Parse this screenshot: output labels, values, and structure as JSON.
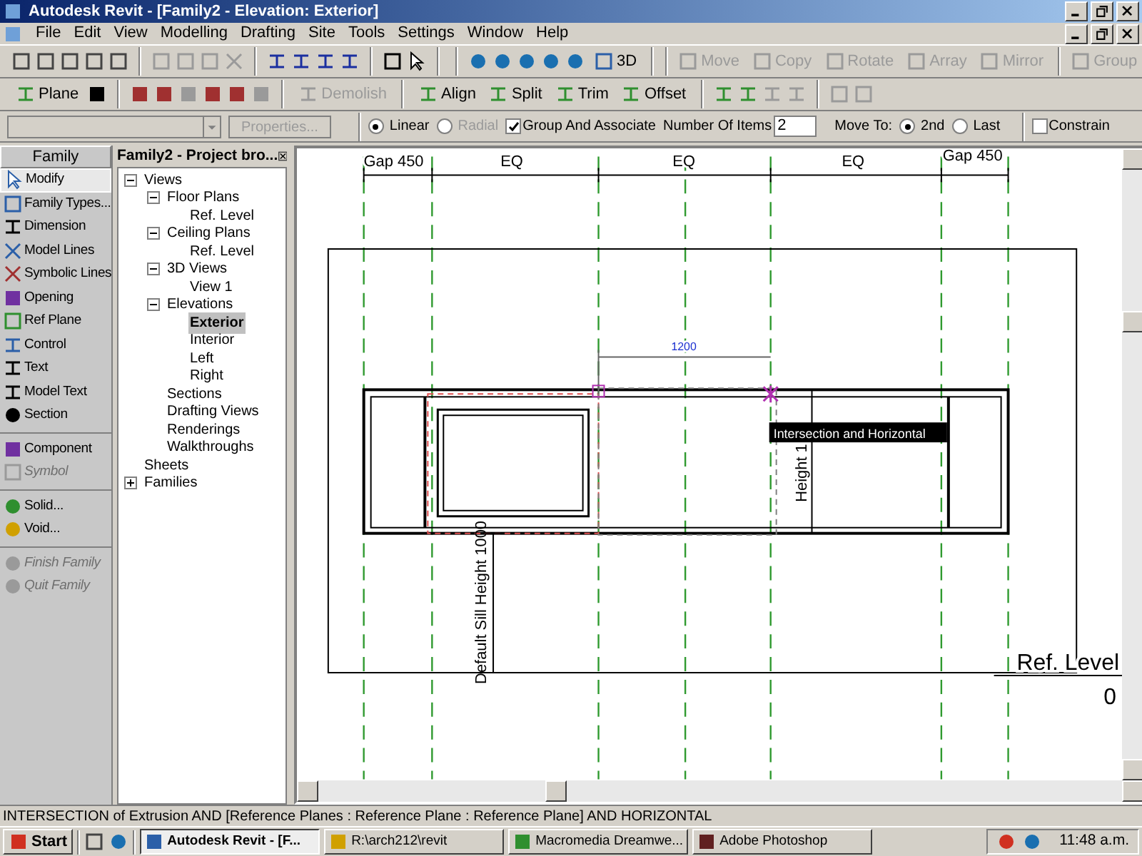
{
  "window": {
    "title": "Autodesk Revit - [Family2 - Elevation: Exterior]"
  },
  "menu": [
    "File",
    "Edit",
    "View",
    "Modelling",
    "Drafting",
    "Site",
    "Tools",
    "Settings",
    "Window",
    "Help"
  ],
  "toolbar_1": [
    {
      "label": "3D",
      "disabled": false
    },
    {
      "label": "Move",
      "disabled": true
    },
    {
      "label": "Copy",
      "disabled": true
    },
    {
      "label": "Rotate",
      "disabled": true
    },
    {
      "label": "Array",
      "disabled": true
    },
    {
      "label": "Mirror",
      "disabled": true
    },
    {
      "label": "Group",
      "disabled": true
    }
  ],
  "toolbar_2": [
    {
      "label": "Plane",
      "disabled": false
    },
    {
      "label": "Demolish",
      "disabled": true
    },
    {
      "label": "Align",
      "disabled": false
    },
    {
      "label": "Split",
      "disabled": false
    },
    {
      "label": "Trim",
      "disabled": false
    },
    {
      "label": "Offset",
      "disabled": false
    }
  ],
  "options_bar": {
    "properties_button": {
      "label": "Properties...",
      "disabled": true
    },
    "array_type": [
      {
        "label": "Linear",
        "selected": true,
        "disabled": false
      },
      {
        "label": "Radial",
        "selected": false,
        "disabled": true
      }
    ],
    "group_and_associate": {
      "label": "Group And Associate",
      "checked": true
    },
    "number_of_items": {
      "label": "Number Of Items",
      "value": "2"
    },
    "move_to": {
      "label": "Move To:",
      "options": [
        {
          "label": "2nd",
          "selected": true
        },
        {
          "label": "Last",
          "selected": false
        }
      ]
    },
    "constrain": {
      "label": "Constrain",
      "checked": false
    }
  },
  "family_panel": {
    "title": "Family",
    "items": [
      {
        "label": "Modify",
        "selected": true,
        "disabled": false
      },
      {
        "label": "Family Types...",
        "selected": false,
        "disabled": false
      },
      {
        "label": "Dimension",
        "selected": false,
        "disabled": false
      },
      {
        "label": "Model Lines",
        "selected": false,
        "disabled": false
      },
      {
        "label": "Symbolic Lines",
        "selected": false,
        "disabled": false
      },
      {
        "label": "Opening",
        "selected": false,
        "disabled": false
      },
      {
        "label": "Ref Plane",
        "selected": false,
        "disabled": false
      },
      {
        "label": "Control",
        "selected": false,
        "disabled": false
      },
      {
        "label": "Text",
        "selected": false,
        "disabled": false
      },
      {
        "label": "Model Text",
        "selected": false,
        "disabled": false
      },
      {
        "label": "Section",
        "selected": false,
        "disabled": false
      },
      {
        "label": "Component",
        "selected": false,
        "disabled": false
      },
      {
        "label": "Symbol",
        "selected": false,
        "disabled": true
      },
      {
        "label": "Solid...",
        "selected": false,
        "disabled": false
      },
      {
        "label": "Void...",
        "selected": false,
        "disabled": false
      },
      {
        "label": "Finish Family",
        "selected": false,
        "disabled": true
      },
      {
        "label": "Quit Family",
        "selected": false,
        "disabled": true
      }
    ]
  },
  "project_browser": {
    "title": "Family2 - Project bro...",
    "tree": [
      {
        "label": "Views",
        "expanded": true,
        "selected": false,
        "children": [
          {
            "label": "Floor Plans",
            "expanded": true,
            "selected": false,
            "children": [
              {
                "label": "Ref. Level",
                "selected": false
              }
            ]
          },
          {
            "label": "Ceiling Plans",
            "expanded": true,
            "selected": false,
            "children": [
              {
                "label": "Ref. Level",
                "selected": false
              }
            ]
          },
          {
            "label": "3D Views",
            "expanded": true,
            "selected": false,
            "children": [
              {
                "label": "View 1",
                "selected": false
              }
            ]
          },
          {
            "label": "Elevations",
            "expanded": true,
            "selected": false,
            "children": [
              {
                "label": "Exterior",
                "selected": true
              },
              {
                "label": "Interior",
                "selected": false
              },
              {
                "label": "Left",
                "selected": false
              },
              {
                "label": "Right",
                "selected": false
              }
            ]
          },
          {
            "label": "Sections",
            "selected": false
          },
          {
            "label": "Drafting Views",
            "selected": false
          },
          {
            "label": "Renderings",
            "selected": false
          },
          {
            "label": "Walkthroughs",
            "selected": false
          }
        ]
      },
      {
        "label": "Sheets",
        "selected": false
      },
      {
        "label": "Families",
        "expanded": false,
        "selected": false
      }
    ]
  },
  "drawing": {
    "top_dimensions": [
      "Gap 450",
      "EQ",
      "EQ",
      "EQ",
      "Gap 450"
    ],
    "temp_dimension": "1200",
    "sill_dimension": "Default Sill Height 1000",
    "height_dimension": "Height 1",
    "tooltip": "Intersection and Horizontal",
    "level_name": "Ref. Level",
    "level_value": "0"
  },
  "status_bar": "INTERSECTION  of Extrusion AND [Reference Planes : Reference Plane : Reference Plane] AND HORIZONTAL",
  "taskbar": {
    "start": "Start",
    "tasks": [
      {
        "label": "Autodesk Revit - [F...",
        "selected": true
      },
      {
        "label": "R:\\arch212\\revit",
        "selected": false
      },
      {
        "label": "Macromedia Dreamwe...",
        "selected": false
      },
      {
        "label": "Adobe Photoshop",
        "selected": false
      }
    ],
    "clock": "11:48 a.m."
  }
}
